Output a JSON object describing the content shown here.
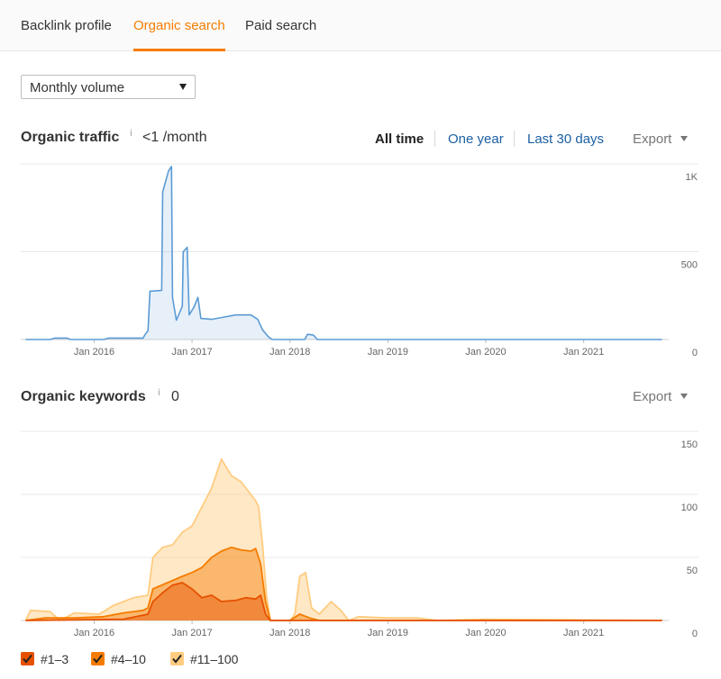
{
  "tabs": [
    {
      "label": "Backlink profile"
    },
    {
      "label": "Organic search"
    },
    {
      "label": "Paid search"
    }
  ],
  "volume_select": {
    "value": "Monthly volume"
  },
  "traffic_section": {
    "title": "Organic traffic",
    "info": "i",
    "value": "<1 /month",
    "ranges": [
      "All time",
      "One year",
      "Last 30 days"
    ],
    "active_range": "All time",
    "export_label": "Export"
  },
  "keywords_section": {
    "title": "Organic keywords",
    "info": "i",
    "value": "0",
    "export_label": "Export"
  },
  "legend": [
    {
      "label": "#1–3",
      "color": "#e65100"
    },
    {
      "label": "#4–10",
      "color": "#f57c00"
    },
    {
      "label": "#11–100",
      "color": "#ffcc80"
    }
  ],
  "chart_data": [
    {
      "type": "area",
      "title": "Organic traffic",
      "x_ticks": [
        "Jan 2016",
        "Jan 2017",
        "Jan 2018",
        "Jan 2019",
        "Jan 2020",
        "Jan 2021"
      ],
      "y_ticks": [
        "1K",
        "500",
        "0"
      ],
      "ylim": [
        0,
        1000
      ],
      "xlim": [
        2015.25,
        2021.85
      ],
      "grid": true,
      "series": [
        {
          "color": "#5b9bd5",
          "points": [
            [
              2015.3,
              0
            ],
            [
              2015.55,
              0
            ],
            [
              2015.6,
              8
            ],
            [
              2015.72,
              8
            ],
            [
              2015.76,
              0
            ],
            [
              2016.1,
              0
            ],
            [
              2016.15,
              8
            ],
            [
              2016.5,
              8
            ],
            [
              2016.52,
              28
            ],
            [
              2016.55,
              50
            ],
            [
              2016.57,
              275
            ],
            [
              2016.69,
              280
            ],
            [
              2016.7,
              840
            ],
            [
              2016.76,
              960
            ],
            [
              2016.79,
              985
            ],
            [
              2016.8,
              240
            ],
            [
              2016.84,
              110
            ],
            [
              2016.87,
              150
            ],
            [
              2016.9,
              190
            ],
            [
              2016.91,
              500
            ],
            [
              2016.95,
              525
            ],
            [
              2016.97,
              140
            ],
            [
              2017.02,
              185
            ],
            [
              2017.06,
              240
            ],
            [
              2017.09,
              120
            ],
            [
              2017.2,
              115
            ],
            [
              2017.3,
              125
            ],
            [
              2017.45,
              140
            ],
            [
              2017.6,
              140
            ],
            [
              2017.67,
              115
            ],
            [
              2017.72,
              55
            ],
            [
              2017.78,
              15
            ],
            [
              2017.82,
              0
            ],
            [
              2018.15,
              0
            ],
            [
              2018.18,
              30
            ],
            [
              2018.24,
              25
            ],
            [
              2018.28,
              0
            ],
            [
              2021.8,
              0
            ]
          ]
        }
      ]
    },
    {
      "type": "area",
      "title": "Organic keywords",
      "x_ticks": [
        "Jan 2016",
        "Jan 2017",
        "Jan 2018",
        "Jan 2019",
        "Jan 2020",
        "Jan 2021"
      ],
      "y_ticks": [
        "150",
        "100",
        "50",
        "0"
      ],
      "ylim": [
        0,
        150
      ],
      "xlim": [
        2015.25,
        2021.85
      ],
      "grid": true,
      "series": [
        {
          "name": "#11–100",
          "color": "#ffcc80",
          "points": [
            [
              2015.3,
              0
            ],
            [
              2015.35,
              8
            ],
            [
              2015.55,
              7
            ],
            [
              2015.65,
              0
            ],
            [
              2015.8,
              6
            ],
            [
              2016.05,
              5
            ],
            [
              2016.2,
              12
            ],
            [
              2016.4,
              18
            ],
            [
              2016.55,
              20
            ],
            [
              2016.6,
              50
            ],
            [
              2016.7,
              58
            ],
            [
              2016.8,
              60
            ],
            [
              2016.9,
              70
            ],
            [
              2017.0,
              75
            ],
            [
              2017.1,
              90
            ],
            [
              2017.2,
              105
            ],
            [
              2017.3,
              128
            ],
            [
              2017.4,
              115
            ],
            [
              2017.5,
              110
            ],
            [
              2017.6,
              100
            ],
            [
              2017.65,
              95
            ],
            [
              2017.68,
              90
            ],
            [
              2017.72,
              60
            ],
            [
              2017.76,
              20
            ],
            [
              2017.8,
              0
            ],
            [
              2018.0,
              0
            ],
            [
              2018.05,
              5
            ],
            [
              2018.1,
              35
            ],
            [
              2018.16,
              38
            ],
            [
              2018.22,
              10
            ],
            [
              2018.3,
              5
            ],
            [
              2018.42,
              15
            ],
            [
              2018.52,
              8
            ],
            [
              2018.6,
              0
            ],
            [
              2018.7,
              3
            ],
            [
              2019.0,
              2
            ],
            [
              2019.3,
              2
            ],
            [
              2019.5,
              0
            ],
            [
              2020.0,
              1
            ],
            [
              2021.8,
              0
            ]
          ]
        },
        {
          "name": "#4–10",
          "color": "#f57c00",
          "points": [
            [
              2015.3,
              0
            ],
            [
              2015.5,
              2
            ],
            [
              2015.8,
              2
            ],
            [
              2016.1,
              3
            ],
            [
              2016.3,
              6
            ],
            [
              2016.5,
              8
            ],
            [
              2016.55,
              10
            ],
            [
              2016.6,
              25
            ],
            [
              2016.75,
              30
            ],
            [
              2016.9,
              35
            ],
            [
              2017.0,
              38
            ],
            [
              2017.1,
              42
            ],
            [
              2017.2,
              50
            ],
            [
              2017.3,
              55
            ],
            [
              2017.4,
              58
            ],
            [
              2017.5,
              56
            ],
            [
              2017.6,
              55
            ],
            [
              2017.65,
              57
            ],
            [
              2017.7,
              45
            ],
            [
              2017.75,
              15
            ],
            [
              2017.8,
              0
            ],
            [
              2018.0,
              0
            ],
            [
              2018.1,
              5
            ],
            [
              2018.2,
              2
            ],
            [
              2018.3,
              0
            ],
            [
              2021.8,
              0
            ]
          ]
        },
        {
          "name": "#1–3",
          "color": "#e65100",
          "points": [
            [
              2015.3,
              0
            ],
            [
              2016.3,
              1
            ],
            [
              2016.55,
              5
            ],
            [
              2016.6,
              15
            ],
            [
              2016.7,
              22
            ],
            [
              2016.8,
              28
            ],
            [
              2016.9,
              30
            ],
            [
              2017.0,
              25
            ],
            [
              2017.1,
              18
            ],
            [
              2017.2,
              20
            ],
            [
              2017.3,
              15
            ],
            [
              2017.45,
              16
            ],
            [
              2017.55,
              18
            ],
            [
              2017.65,
              17
            ],
            [
              2017.7,
              20
            ],
            [
              2017.75,
              5
            ],
            [
              2017.8,
              0
            ],
            [
              2021.8,
              0
            ]
          ]
        }
      ]
    }
  ]
}
